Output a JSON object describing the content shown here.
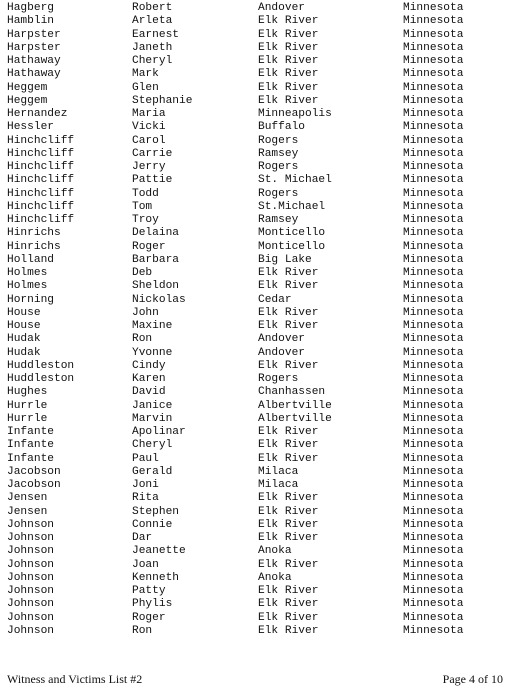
{
  "table": {
    "columns": [
      "last_name",
      "first_name",
      "city",
      "state"
    ],
    "rows": [
      [
        "Hagberg",
        "Robert",
        "Andover",
        "Minnesota"
      ],
      [
        "Hamblin",
        "Arleta",
        "Elk River",
        "Minnesota"
      ],
      [
        "Harpster",
        "Earnest",
        "Elk River",
        "Minnesota"
      ],
      [
        "Harpster",
        "Janeth",
        "Elk River",
        "Minnesota"
      ],
      [
        "Hathaway",
        "Cheryl",
        "Elk River",
        "Minnesota"
      ],
      [
        "Hathaway",
        "Mark",
        "Elk River",
        "Minnesota"
      ],
      [
        "Heggem",
        "Glen",
        "Elk River",
        "Minnesota"
      ],
      [
        "Heggem",
        "Stephanie",
        "Elk River",
        "Minnesota"
      ],
      [
        "Hernandez",
        "Maria",
        "Minneapolis",
        "Minnesota"
      ],
      [
        "Hessler",
        "Vicki",
        "Buffalo",
        "Minnesota"
      ],
      [
        "Hinchcliff",
        "Carol",
        "Rogers",
        "Minnesota"
      ],
      [
        "Hinchcliff",
        "Carrie",
        "Ramsey",
        "Minnesota"
      ],
      [
        "Hinchcliff",
        "Jerry",
        "Rogers",
        "Minnesota"
      ],
      [
        "Hinchcliff",
        "Pattie",
        "St. Michael",
        "Minnesota"
      ],
      [
        "Hinchcliff",
        "Todd",
        "Rogers",
        "Minnesota"
      ],
      [
        "Hinchcliff",
        "Tom",
        "St.Michael",
        "Minnesota"
      ],
      [
        "Hinchcliff",
        "Troy",
        "Ramsey",
        "Minnesota"
      ],
      [
        "Hinrichs",
        "Delaina",
        "Monticello",
        "Minnesota"
      ],
      [
        "Hinrichs",
        "Roger",
        "Monticello",
        "Minnesota"
      ],
      [
        "Holland",
        "Barbara",
        "Big Lake",
        "Minnesota"
      ],
      [
        "Holmes",
        "Deb",
        "Elk River",
        "Minnesota"
      ],
      [
        "Holmes",
        "Sheldon",
        "Elk River",
        "Minnesota"
      ],
      [
        "Horning",
        "Nickolas",
        "Cedar",
        "Minnesota"
      ],
      [
        "House",
        "John",
        "Elk River",
        "Minnesota"
      ],
      [
        "House",
        "Maxine",
        "Elk River",
        "Minnesota"
      ],
      [
        "Hudak",
        "Ron",
        "Andover",
        "Minnesota"
      ],
      [
        "Hudak",
        "Yvonne",
        "Andover",
        "Minnesota"
      ],
      [
        "Huddleston",
        "Cindy",
        "Elk River",
        "Minnesota"
      ],
      [
        "Huddleston",
        "Karen",
        "Rogers",
        "Minnesota"
      ],
      [
        "Hughes",
        "David",
        "Chanhassen",
        "Minnesota"
      ],
      [
        "Hurrle",
        "Janice",
        "Albertville",
        "Minnesota"
      ],
      [
        "Hurrle",
        "Marvin",
        "Albertville",
        "Minnesota"
      ],
      [
        "Infante",
        "Apolinar",
        "Elk River",
        "Minnesota"
      ],
      [
        "Infante",
        "Cheryl",
        "Elk River",
        "Minnesota"
      ],
      [
        "Infante",
        "Paul",
        "Elk River",
        "Minnesota"
      ],
      [
        "Jacobson",
        "Gerald",
        "Milaca",
        "Minnesota"
      ],
      [
        "Jacobson",
        "Joni",
        "Milaca",
        "Minnesota"
      ],
      [
        "Jensen",
        "Rita",
        "Elk River",
        "Minnesota"
      ],
      [
        "Jensen",
        "Stephen",
        "Elk River",
        "Minnesota"
      ],
      [
        "Johnson",
        "Connie",
        "Elk River",
        "Minnesota"
      ],
      [
        "Johnson",
        "Dar",
        "Elk River",
        "Minnesota"
      ],
      [
        "Johnson",
        "Jeanette",
        "Anoka",
        "Minnesota"
      ],
      [
        "Johnson",
        "Joan",
        "Elk River",
        "Minnesota"
      ],
      [
        "Johnson",
        "Kenneth",
        "Anoka",
        "Minnesota"
      ],
      [
        "Johnson",
        "Patty",
        "Elk River",
        "Minnesota"
      ],
      [
        "Johnson",
        "Phylis",
        "Elk River",
        "Minnesota"
      ],
      [
        "Johnson",
        "Roger",
        "Elk River",
        "Minnesota"
      ],
      [
        "Johnson",
        "Ron",
        "Elk River",
        "Minnesota"
      ]
    ]
  },
  "footer": {
    "title": "Witness and Victims List #2",
    "page": "Page 4 of 10"
  }
}
